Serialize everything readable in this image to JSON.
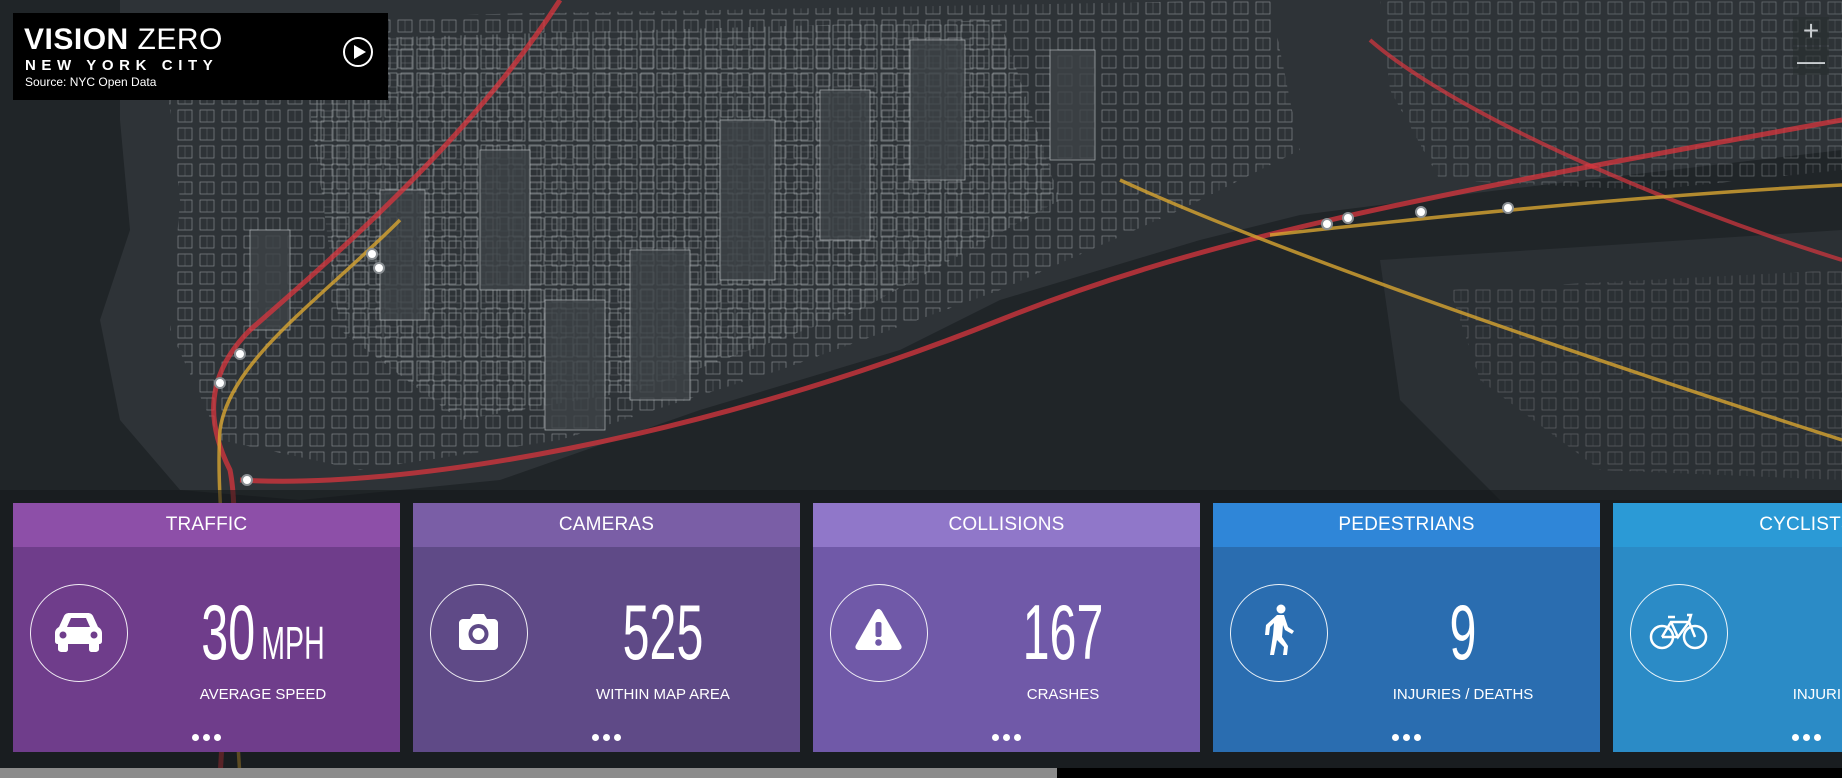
{
  "header": {
    "title_bold": "VISION",
    "title_light": "ZERO",
    "subtitle": "NEW YORK CITY",
    "source": "Source: NYC Open Data"
  },
  "icons": {
    "play": "play-icon",
    "zoom_in": "plus-icon",
    "zoom_out": "minus-icon"
  },
  "zoom": {
    "in_label": "+",
    "out_label": "—"
  },
  "colors": {
    "traffic_header": "#8d4fa8",
    "traffic_body": "#6f3d8b",
    "cameras_header": "#7a5ea6",
    "cameras_body": "#5f4a87",
    "collisions_header": "#9077c9",
    "collisions_body": "#7059a8",
    "pedestrians_header": "#2f86d8",
    "pedestrians_body": "#2a6db0",
    "cyclists_header": "#2b9ad6",
    "cyclists_body": "#2b8bc6",
    "route_red": "#d9363e",
    "route_yellow": "#d8a531"
  },
  "cards": [
    {
      "title": "TRAFFIC",
      "value": "30",
      "unit": "MPH",
      "label": "AVERAGE SPEED",
      "icon": "car-icon"
    },
    {
      "title": "CAMERAS",
      "value": "525",
      "unit": "",
      "label": "WITHIN MAP AREA",
      "icon": "camera-icon"
    },
    {
      "title": "COLLISIONS",
      "value": "167",
      "unit": "",
      "label": "CRASHES",
      "icon": "warning-icon"
    },
    {
      "title": "PEDESTRIANS",
      "value": "9",
      "unit": "",
      "label": "INJURIES / DEATHS",
      "icon": "pedestrian-icon"
    },
    {
      "title": "CYCLISTS",
      "value": "",
      "unit": "",
      "label": "INJURIES / DEATHS",
      "icon": "bicycle-icon"
    }
  ],
  "scrollbar": {
    "position": 0.0
  }
}
